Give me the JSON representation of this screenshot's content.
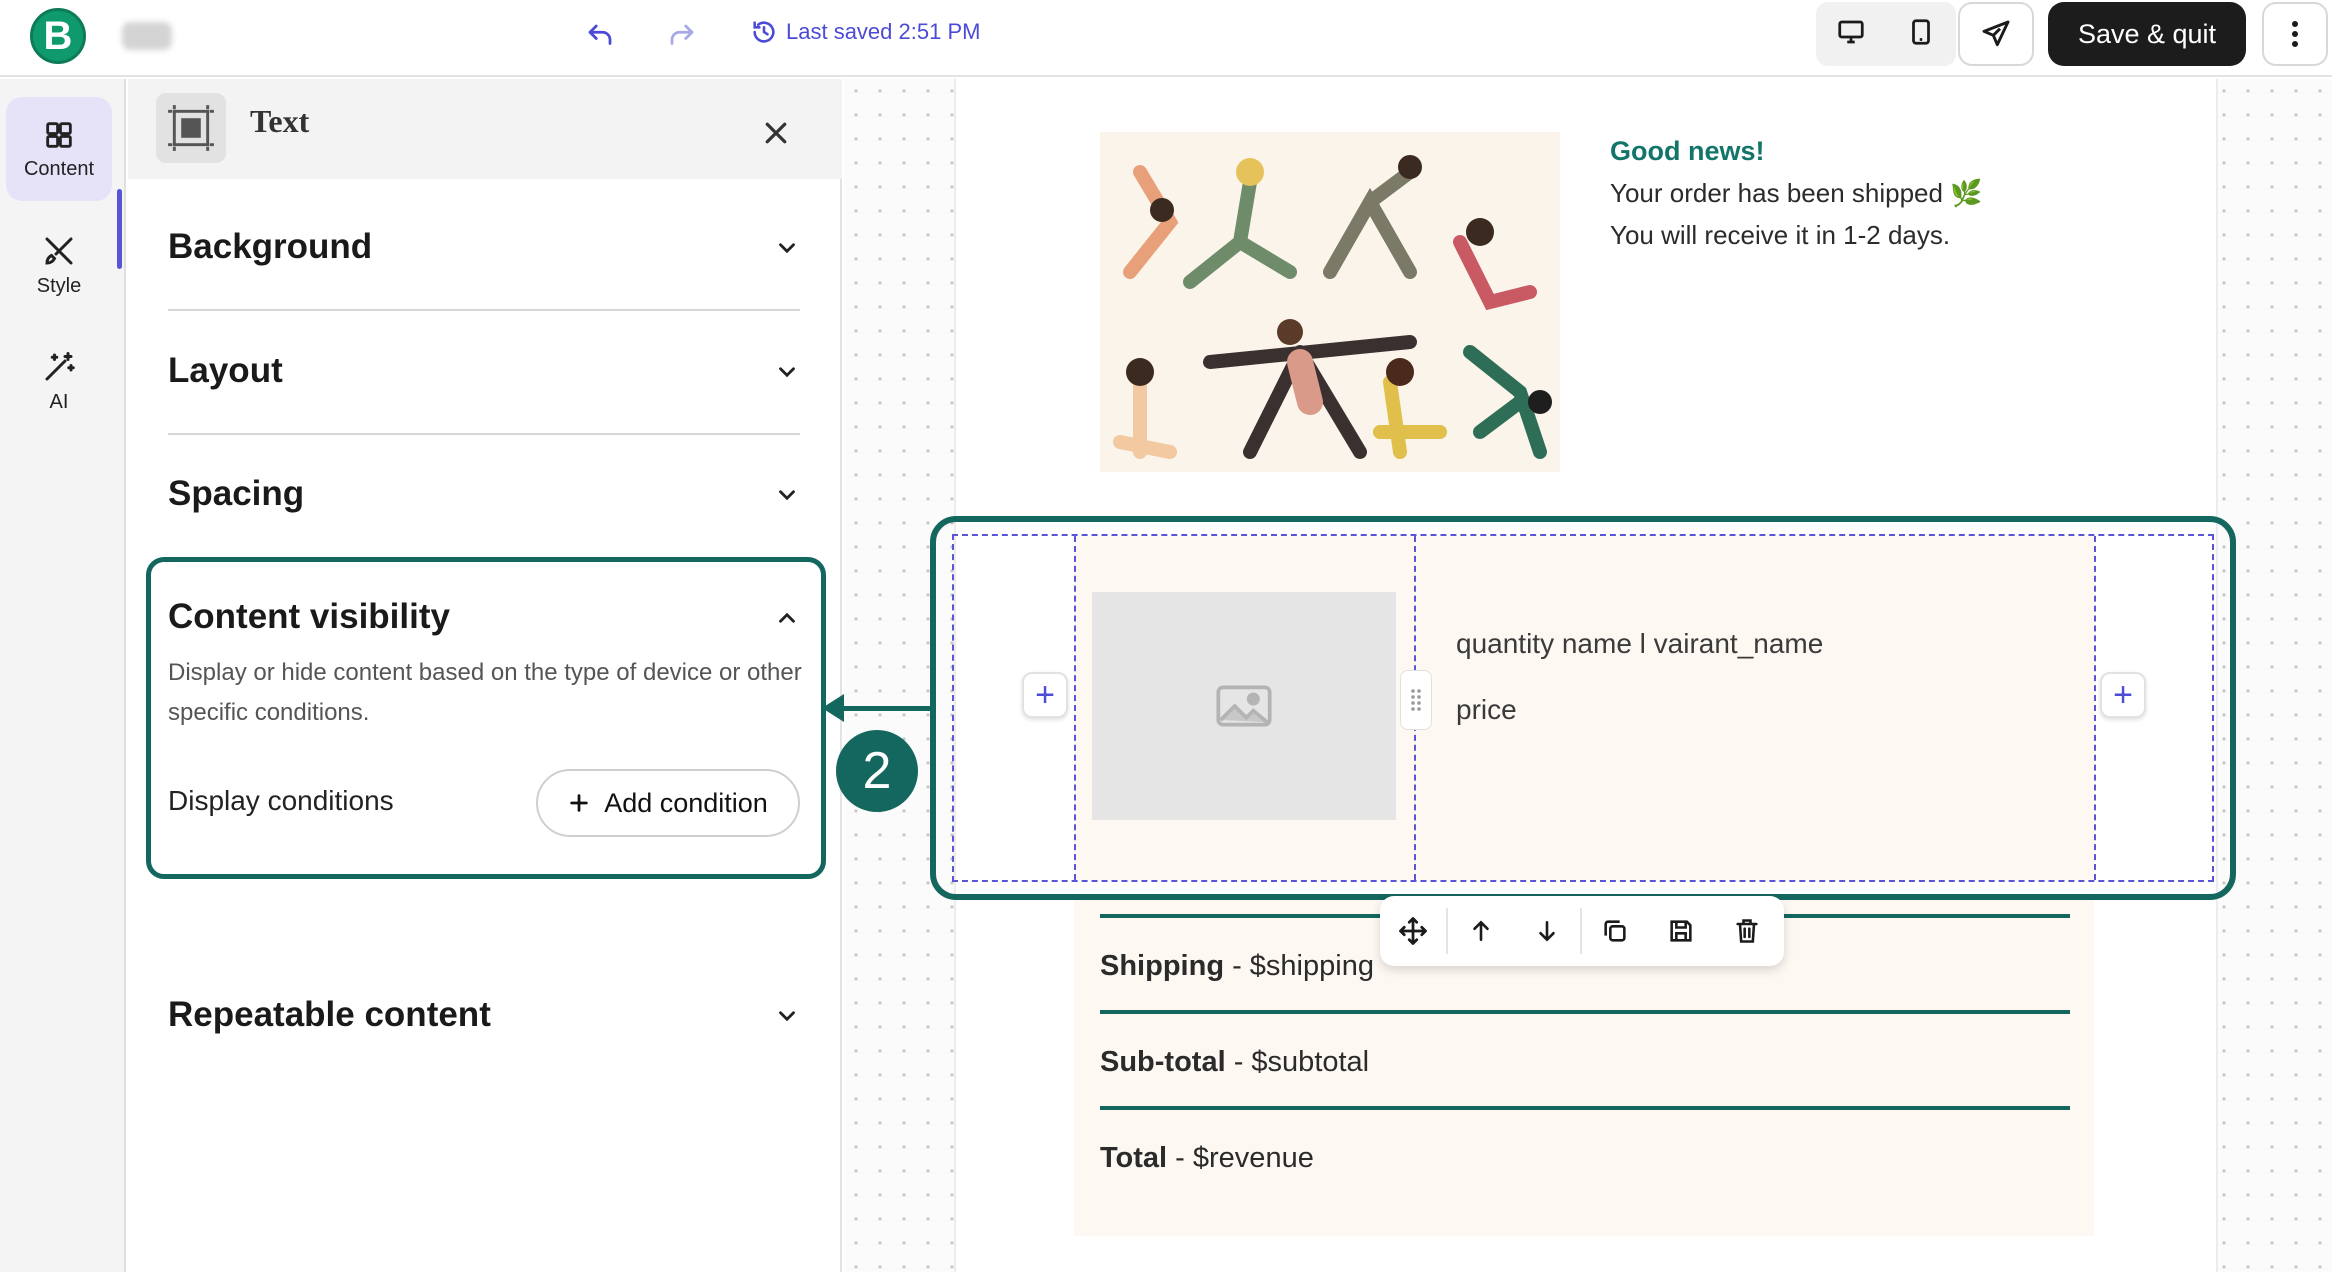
{
  "topbar": {
    "logo_letter": "B",
    "last_saved": "Last saved 2:51 PM",
    "save_quit": "Save & quit"
  },
  "rail": {
    "items": [
      {
        "label": "Content",
        "icon": "grid-icon"
      },
      {
        "label": "Style",
        "icon": "brush-icon"
      },
      {
        "label": "AI",
        "icon": "magic-wand-icon"
      }
    ]
  },
  "panel": {
    "title": "Text",
    "sections": {
      "background": "Background",
      "layout": "Layout",
      "spacing": "Spacing",
      "content_visibility": "Content visibility",
      "repeatable": "Repeatable content"
    },
    "visibility_desc": "Display or hide content based on the type of device or other specific conditions.",
    "display_conditions_label": "Display conditions",
    "add_condition": "Add condition"
  },
  "email": {
    "good_news": "Good news!",
    "line1": "Your order has been shipped 🌿",
    "line2": "You will receive it in 1-2 days.",
    "product_name": "quantity name l vairant_name",
    "product_price": "price",
    "summary": [
      {
        "label": "Shipping",
        "value": " - $shipping"
      },
      {
        "label": "Sub-total",
        "value": " - $subtotal"
      },
      {
        "label": "Total",
        "value": " - $revenue"
      }
    ]
  },
  "callout": {
    "number": "2"
  },
  "colors": {
    "brand": "#0f9a6e",
    "accent": "#5a54d6",
    "callout": "#13675f",
    "good_news": "#13756a"
  }
}
